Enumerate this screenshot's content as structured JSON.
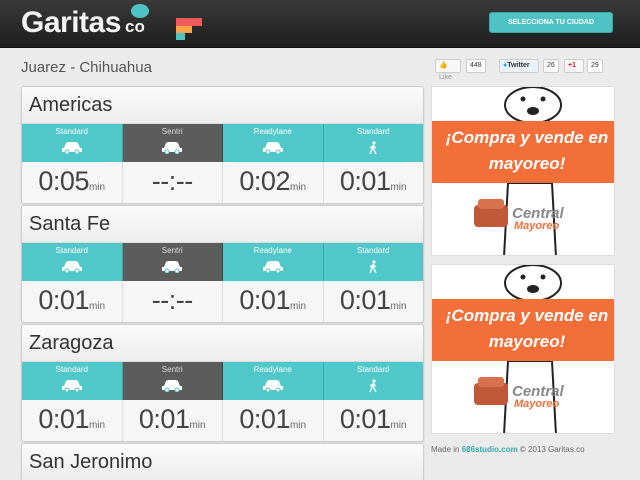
{
  "header": {
    "logo_text": "Garitas",
    "logo_suffix": "co",
    "city_button": "SELECCIONA TU CIUDAD"
  },
  "location": "Juarez - Chihuahua",
  "social": {
    "like_label": "Like",
    "like_count": "448",
    "tweet_label": "Twitter",
    "tweet_count": "26",
    "gplus_label": "+1",
    "gplus_count": "29"
  },
  "lane_labels": {
    "standard": "Standard",
    "sentri": "Sentri",
    "readylane": "Readylane"
  },
  "crossings": [
    {
      "name": "Americas",
      "lanes": [
        {
          "label": "Standard",
          "icon": "car-icon",
          "value": "0:05",
          "unit": "min"
        },
        {
          "label": "Sentri",
          "icon": "car-icon",
          "value": "--:--",
          "unit": ""
        },
        {
          "label": "Readylane",
          "icon": "car-icon",
          "value": "0:02",
          "unit": "min"
        },
        {
          "label": "Standard",
          "icon": "pedestrian-icon",
          "value": "0:01",
          "unit": "min"
        }
      ]
    },
    {
      "name": "Santa Fe",
      "lanes": [
        {
          "label": "Standard",
          "icon": "car-icon",
          "value": "0:01",
          "unit": "min"
        },
        {
          "label": "Sentri",
          "icon": "car-icon",
          "value": "--:--",
          "unit": ""
        },
        {
          "label": "Readylane",
          "icon": "car-icon",
          "value": "0:01",
          "unit": "min"
        },
        {
          "label": "Standard",
          "icon": "pedestrian-icon",
          "value": "0:01",
          "unit": "min"
        }
      ]
    },
    {
      "name": "Zaragoza",
      "lanes": [
        {
          "label": "Standard",
          "icon": "car-icon",
          "value": "0:01",
          "unit": "min"
        },
        {
          "label": "Sentri",
          "icon": "car-icon",
          "value": "0:01",
          "unit": "min"
        },
        {
          "label": "Readylane",
          "icon": "car-icon",
          "value": "0:01",
          "unit": "min"
        },
        {
          "label": "Standard",
          "icon": "pedestrian-icon",
          "value": "0:01",
          "unit": "min"
        }
      ]
    },
    {
      "name": "San Jeronimo"
    }
  ],
  "ads": [
    {
      "headline": "¡Compra y vende en mayoreo!",
      "brand_top": "Central",
      "brand_bottom": "Mayoreo"
    },
    {
      "headline": "¡Compra y vende en mayoreo!",
      "brand_top": "Central",
      "brand_bottom": "Mayoreo"
    }
  ],
  "footer": {
    "prefix": "Made in ",
    "link": "686studio.com",
    "suffix": " © 2013 Garitas.co"
  },
  "colors": {
    "teal": "#50c7c8",
    "dark_lane": "#5c5c5c",
    "ad_orange": "#f36f3a",
    "topbar": "#2a2a2a"
  }
}
